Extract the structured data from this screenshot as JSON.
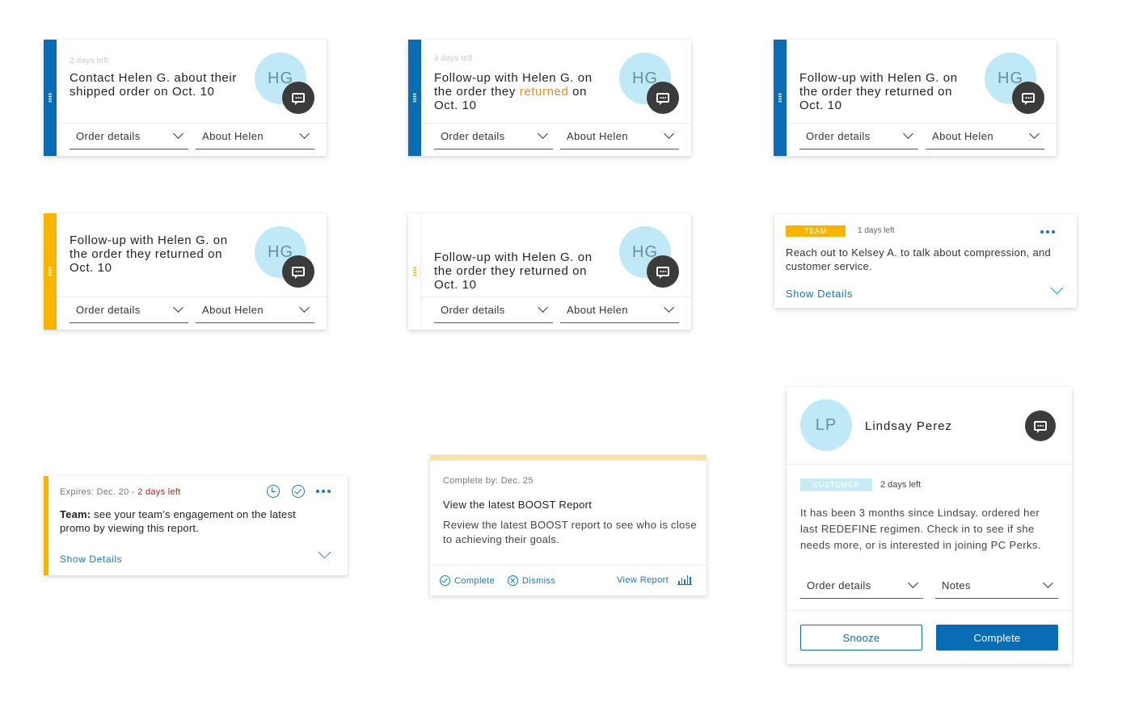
{
  "task_cards": [
    {
      "days_left": "2 days left",
      "title_parts": [
        "Contact Helen G. about their shipped order on Oct. 10",
        "",
        ""
      ],
      "initials": "HG",
      "dropdown_a": "Order details",
      "dropdown_b": "About Helen"
    },
    {
      "days_left": "4 days left",
      "title_parts": [
        "Follow-up with Helen G. on the order they ",
        "returned",
        " on Oct. 10"
      ],
      "initials": "HG",
      "dropdown_a": "Order details",
      "dropdown_b": "About Helen"
    },
    {
      "days_left": "",
      "title_parts": [
        "Follow-up with Helen G. on the order they returned on Oct. 10",
        "",
        ""
      ],
      "initials": "HG",
      "dropdown_a": "Order details",
      "dropdown_b": "About Helen"
    },
    {
      "days_left": "",
      "title_parts": [
        "Follow-up with Helen G. on the order they returned on Oct. 10",
        "",
        ""
      ],
      "initials": "HG",
      "dropdown_a": "Order details",
      "dropdown_b": "About Helen"
    },
    {
      "days_left": "",
      "title_parts": [
        "Follow-up with Helen G. on the order they returned on Oct. 10",
        "",
        ""
      ],
      "initials": "HG",
      "dropdown_a": "Order details",
      "dropdown_b": "About Helen"
    }
  ],
  "team_card": {
    "badge": "TEAM",
    "days_left": "1 days left",
    "text": "Reach out to Kelsey A. to talk about compression, and customer service.",
    "link": "Show Details"
  },
  "expire_card": {
    "expires": "Expires: Dec. 20 - ",
    "days_left": "2 days left",
    "text_bold": "Team:",
    "text": " see your team’s engagement on the latest promo by viewing this report.",
    "link": "Show Details"
  },
  "boost_card": {
    "complete_by": "Complete by: Dec. 25",
    "title": "View the latest BOOST Report",
    "text": "Review the latest BOOST report to see who is close to achieving their goals.",
    "complete_label": "Complete",
    "dismiss_label": "Dismiss",
    "view_report_label": "View Report"
  },
  "lindsay_card": {
    "initials": "LP",
    "name": "Lindsay Perez",
    "badge": "CUSTOMER",
    "days_left": "2 days left",
    "text": "It has been 3 months since Lindsay. ordered her last REDEFINE regimen. Check in to see if she needs more, or is interested in joining PC Perks.",
    "dropdown_a": "Order details",
    "dropdown_b": "Notes",
    "snooze_label": "Snooze",
    "complete_label": "Complete"
  },
  "colors": {
    "accent_blue": "#0a6cb5",
    "link_blue": "#1676c7",
    "accent_yellow": "#f7b500",
    "accent_orange": "#f08a24",
    "avatar_bg": "#bfe9f7",
    "alert_red": "#b3261e"
  }
}
